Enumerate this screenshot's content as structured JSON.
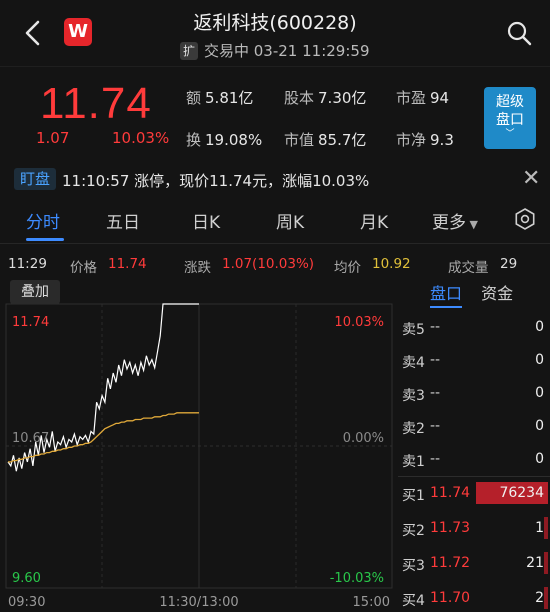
{
  "header": {
    "logo_letter": "W",
    "title": "返利科技(600228)",
    "expand_badge": "扩",
    "status": "交易中 03-21 11:29:59"
  },
  "quote": {
    "price": "11.74",
    "change": "1.07",
    "change_pct": "10.03%",
    "stats": [
      {
        "label": "额",
        "value": "5.81亿"
      },
      {
        "label": "股本",
        "value": "7.30亿"
      },
      {
        "label": "市盈",
        "value": "94"
      },
      {
        "label": "换",
        "value": "19.08%"
      },
      {
        "label": "市值",
        "value": "85.7亿"
      },
      {
        "label": "市净",
        "value": "9.3"
      }
    ],
    "super_button": {
      "line1": "超级",
      "line2": "盘口"
    }
  },
  "watch": {
    "tag": "盯盘",
    "message": "11:10:57 涨停，现价11.74元，涨幅10.03%"
  },
  "tabs": [
    "分时",
    "五日",
    "日K",
    "周K",
    "月K",
    "更多"
  ],
  "info_row": {
    "time": "11:29",
    "price_label": "价格",
    "price_value": "11.74",
    "change_label": "涨跌",
    "change_value": "1.07(10.03%)",
    "avg_label": "均价",
    "avg_value": "10.92",
    "volume_label": "成交量",
    "volume_value": "29"
  },
  "overlay_button": "叠加",
  "axis": {
    "price_top": "11.74",
    "price_mid": "10.67",
    "price_bottom": "9.60",
    "pct_top": "10.03%",
    "pct_mid": "0.00%",
    "pct_bottom": "-10.03%",
    "time_start": "09:30",
    "time_mid": "11:30/13:00",
    "time_end": "15:00"
  },
  "chart_data": {
    "type": "line",
    "ylim": [
      9.6,
      11.74
    ],
    "series": [
      {
        "values": [
          10.55,
          10.52,
          10.6,
          10.48,
          10.58,
          10.5,
          10.62,
          10.55,
          10.65,
          10.52,
          10.7,
          10.6,
          10.75,
          10.62,
          10.72,
          10.66,
          10.78,
          10.63,
          10.7,
          10.68,
          10.74,
          10.66,
          10.72,
          10.7,
          10.76,
          10.68,
          10.74,
          10.72,
          10.75,
          10.7,
          10.78,
          10.76,
          11.0,
          10.95,
          11.05,
          11.0,
          11.18,
          11.1,
          11.22,
          11.15,
          11.28,
          11.2,
          11.32,
          11.25,
          11.3,
          11.22,
          11.28,
          11.2,
          11.3,
          11.24,
          11.35,
          11.28,
          11.32,
          11.26,
          11.38,
          11.5,
          11.74,
          11.74,
          11.74,
          11.74,
          11.74,
          11.74,
          11.74,
          11.74,
          11.74,
          11.74,
          11.74,
          11.74,
          11.74,
          11.74
        ],
        "color": "#ffffff"
      },
      {
        "values": [
          10.55,
          10.55,
          10.56,
          10.56,
          10.57,
          10.57,
          10.58,
          10.58,
          10.59,
          10.59,
          10.6,
          10.6,
          10.61,
          10.61,
          10.62,
          10.62,
          10.63,
          10.63,
          10.64,
          10.64,
          10.65,
          10.65,
          10.66,
          10.66,
          10.67,
          10.67,
          10.68,
          10.68,
          10.69,
          10.69,
          10.7,
          10.72,
          10.74,
          10.76,
          10.78,
          10.8,
          10.81,
          10.82,
          10.83,
          10.84,
          10.84,
          10.85,
          10.85,
          10.86,
          10.86,
          10.86,
          10.87,
          10.87,
          10.87,
          10.88,
          10.88,
          10.88,
          10.88,
          10.89,
          10.89,
          10.89,
          10.9,
          10.9,
          10.91,
          10.91,
          10.91,
          10.92,
          10.92,
          10.92,
          10.92,
          10.92,
          10.92,
          10.92,
          10.92,
          10.92
        ],
        "color": "#e0a93a"
      }
    ]
  },
  "orderbook": {
    "tabs": [
      "盘口",
      "资金"
    ],
    "sell": [
      {
        "label": "卖5",
        "price": "--",
        "vol": "0"
      },
      {
        "label": "卖4",
        "price": "--",
        "vol": "0"
      },
      {
        "label": "卖3",
        "price": "--",
        "vol": "0"
      },
      {
        "label": "卖2",
        "price": "--",
        "vol": "0"
      },
      {
        "label": "卖1",
        "price": "--",
        "vol": "0"
      }
    ],
    "buy": [
      {
        "label": "买1",
        "price": "11.74",
        "vol": "76234",
        "bar": 1.0
      },
      {
        "label": "买2",
        "price": "11.73",
        "vol": "1",
        "bar": 0.02
      },
      {
        "label": "买3",
        "price": "11.72",
        "vol": "21",
        "bar": 0.03
      },
      {
        "label": "买4",
        "price": "11.70",
        "vol": "2",
        "bar": 0.02
      }
    ]
  }
}
